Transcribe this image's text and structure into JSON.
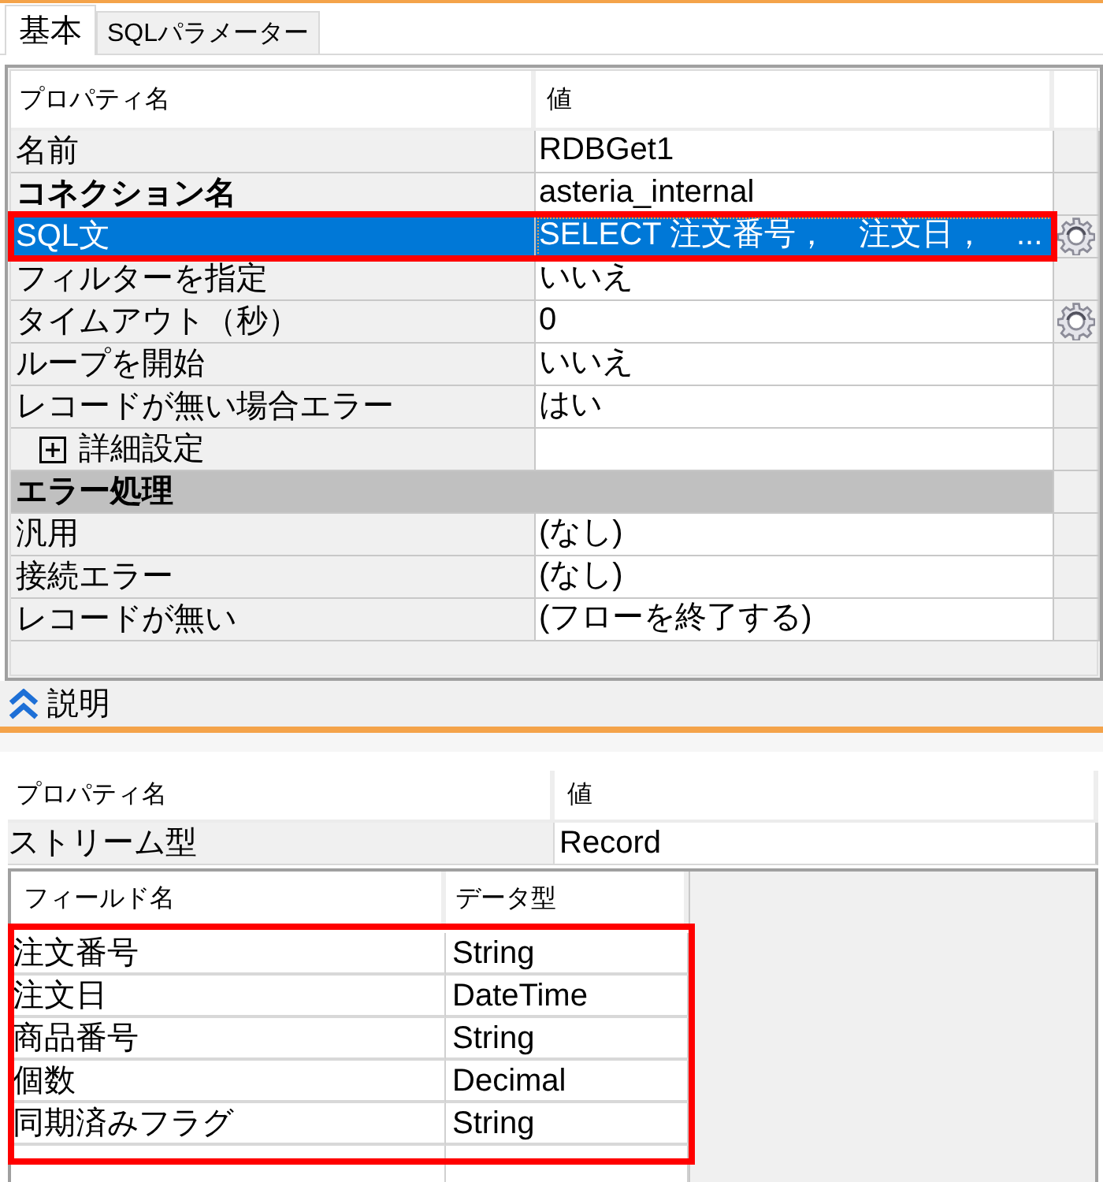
{
  "tabs": [
    {
      "label": "基本",
      "selected": true
    },
    {
      "label": "SQLパラメーター",
      "selected": false
    }
  ],
  "property_grid": {
    "columns": [
      "プロパティ名",
      "値"
    ],
    "rows": [
      {
        "kind": "property",
        "name": "名前",
        "value": "RDBGet1",
        "bold": false,
        "selected": false,
        "button": false,
        "highlighted": false
      },
      {
        "kind": "property",
        "name": "コネクション名",
        "value": "asteria_internal",
        "bold": true,
        "selected": false,
        "button": false,
        "highlighted": false
      },
      {
        "kind": "property",
        "name": "SQL文",
        "value": "SELECT 注文番号，　注文日，　...",
        "bold": false,
        "selected": true,
        "button": true,
        "highlighted": true
      },
      {
        "kind": "property",
        "name": "フィルターを指定",
        "value": "いいえ",
        "bold": false,
        "selected": false,
        "button": false,
        "highlighted": false
      },
      {
        "kind": "property",
        "name": "タイムアウト（秒）",
        "value": "0",
        "bold": false,
        "selected": false,
        "button": true,
        "highlighted": false
      },
      {
        "kind": "property",
        "name": "ループを開始",
        "value": "いいえ",
        "bold": false,
        "selected": false,
        "button": false,
        "highlighted": false
      },
      {
        "kind": "property",
        "name": "レコードが無い場合エラー",
        "value": "はい",
        "bold": false,
        "selected": false,
        "button": false,
        "highlighted": false
      },
      {
        "kind": "group",
        "name": "詳細設定",
        "expanded": false,
        "selected": false
      },
      {
        "kind": "category",
        "name": "エラー処理",
        "selected": false
      },
      {
        "kind": "property",
        "name": "汎用",
        "value": "(なし)",
        "bold": false,
        "selected": false,
        "button": false,
        "highlighted": false
      },
      {
        "kind": "property",
        "name": "接続エラー",
        "value": "(なし)",
        "bold": false,
        "selected": false,
        "button": false,
        "highlighted": false
      },
      {
        "kind": "property",
        "name": "レコードが無い",
        "value": "(フローを終了する)",
        "bold": false,
        "selected": false,
        "button": false,
        "highlighted": false
      }
    ]
  },
  "description": {
    "label": "説明"
  },
  "stream_properties": {
    "columns": [
      "プロパティ名",
      "値"
    ],
    "rows": [
      {
        "name": "ストリーム型",
        "value": "Record"
      }
    ]
  },
  "field_table": {
    "columns": [
      "フィールド名",
      "データ型"
    ],
    "highlighted": true,
    "rows": [
      {
        "name": "注文番号",
        "type": "String"
      },
      {
        "name": "注文日",
        "type": "DateTime"
      },
      {
        "name": "商品番号",
        "type": "String"
      },
      {
        "name": "個数",
        "type": "Decimal"
      },
      {
        "name": "同期済みフラグ",
        "type": "String"
      }
    ]
  }
}
